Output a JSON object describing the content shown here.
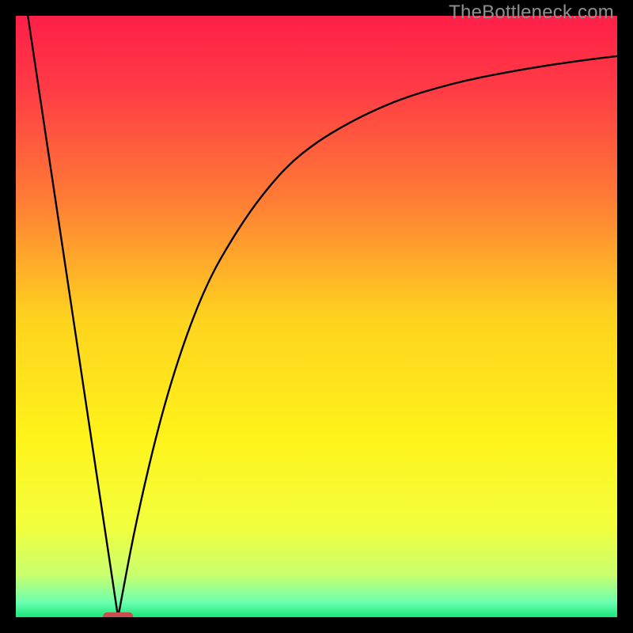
{
  "watermark": "TheBottleneck.com",
  "chart_data": {
    "type": "line",
    "title": "",
    "xlabel": "",
    "ylabel": "",
    "xlim": [
      0,
      100
    ],
    "ylim": [
      0,
      100
    ],
    "optimum_x": 17,
    "gradient_stops": [
      {
        "offset": 0.0,
        "color": "#ff1f48"
      },
      {
        "offset": 0.12,
        "color": "#ff3b45"
      },
      {
        "offset": 0.3,
        "color": "#ff7a36"
      },
      {
        "offset": 0.5,
        "color": "#ffd21f"
      },
      {
        "offset": 0.7,
        "color": "#fff31a"
      },
      {
        "offset": 0.85,
        "color": "#f2ff3e"
      },
      {
        "offset": 0.93,
        "color": "#c9ff6e"
      },
      {
        "offset": 0.975,
        "color": "#6dffb0"
      },
      {
        "offset": 1.0,
        "color": "#18e87a"
      }
    ],
    "series": [
      {
        "name": "left-curve",
        "x": [
          2,
          17
        ],
        "y": [
          100,
          0
        ]
      },
      {
        "name": "right-curve",
        "x": [
          17,
          20,
          24,
          28,
          32,
          36,
          40,
          45,
          50,
          55,
          60,
          65,
          70,
          75,
          80,
          85,
          90,
          95,
          100
        ],
        "y": [
          0,
          16,
          33,
          46,
          56,
          63,
          69,
          75,
          79,
          82,
          84.5,
          86.5,
          88,
          89.3,
          90.3,
          91.2,
          92,
          92.7,
          93.3
        ]
      }
    ],
    "marker": {
      "x": 17,
      "y": 0,
      "width": 5,
      "height": 1.6,
      "color": "#cc4d4d"
    }
  }
}
